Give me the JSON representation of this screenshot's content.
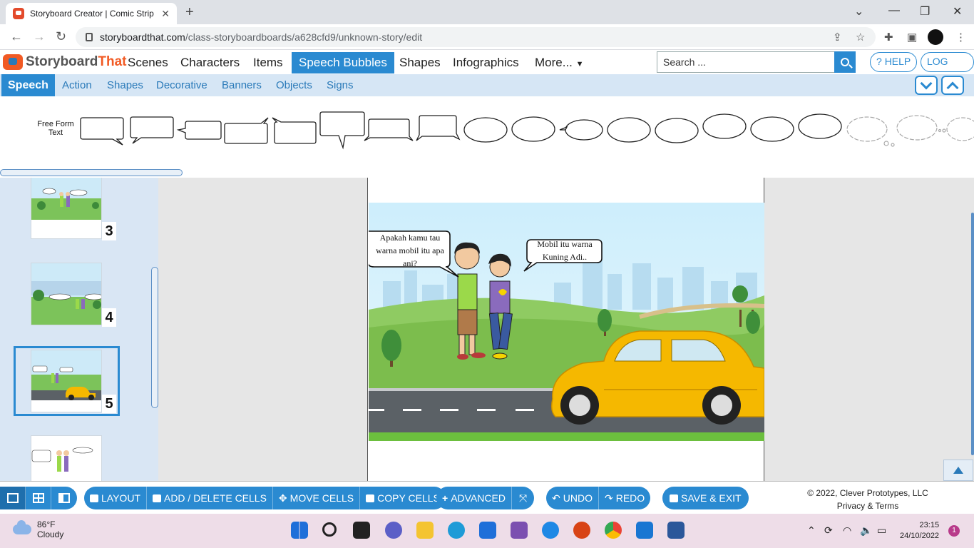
{
  "browser": {
    "tab_title": "Storyboard Creator | Comic Strip",
    "url_host": "storyboardthat.com",
    "url_path": "/class-storyboardboards/a628cfd9/unknown-story/edit"
  },
  "site": {
    "logo_word1": "Storyboard",
    "logo_word2": "That",
    "nav": [
      "Scenes",
      "Characters",
      "Items",
      "Speech Bubbles",
      "Shapes",
      "Infographics",
      "More..."
    ],
    "active_nav": "Speech Bubbles",
    "search_placeholder": "Search ...",
    "help_label": "HELP",
    "logout_label": "LOG OUT"
  },
  "subnav": {
    "items": [
      "Speech",
      "Action",
      "Shapes",
      "Decorative",
      "Banners",
      "Objects",
      "Signs"
    ],
    "active": "Speech"
  },
  "palette": {
    "free_form_label": "Free Form Text"
  },
  "thumbnails": [
    {
      "number": "3"
    },
    {
      "number": "4"
    },
    {
      "number": "5",
      "selected": true
    }
  ],
  "scene": {
    "bubble_left": "Apakah kamu tau warna mobil itu apa ani?",
    "bubble_right": "Mobil itu warna Kuning Adi.."
  },
  "toolbar": {
    "layout": "LAYOUT",
    "add_delete": "ADD / DELETE CELLS",
    "move": "MOVE CELLS",
    "copy": "COPY CELLS",
    "advanced": "ADVANCED",
    "undo": "UNDO",
    "redo": "REDO",
    "save_exit": "SAVE & EXIT",
    "copyright": "© 2022, Clever Prototypes, LLC",
    "privacy": "Privacy & Terms"
  },
  "taskbar": {
    "temperature": "86°F",
    "weather": "Cloudy",
    "time": "23:15",
    "date": "24/10/2022",
    "notifications": "1"
  },
  "colors": {
    "accent": "#2a8ad1",
    "brand_orange": "#f15a24",
    "car_yellow": "#f5b800"
  }
}
